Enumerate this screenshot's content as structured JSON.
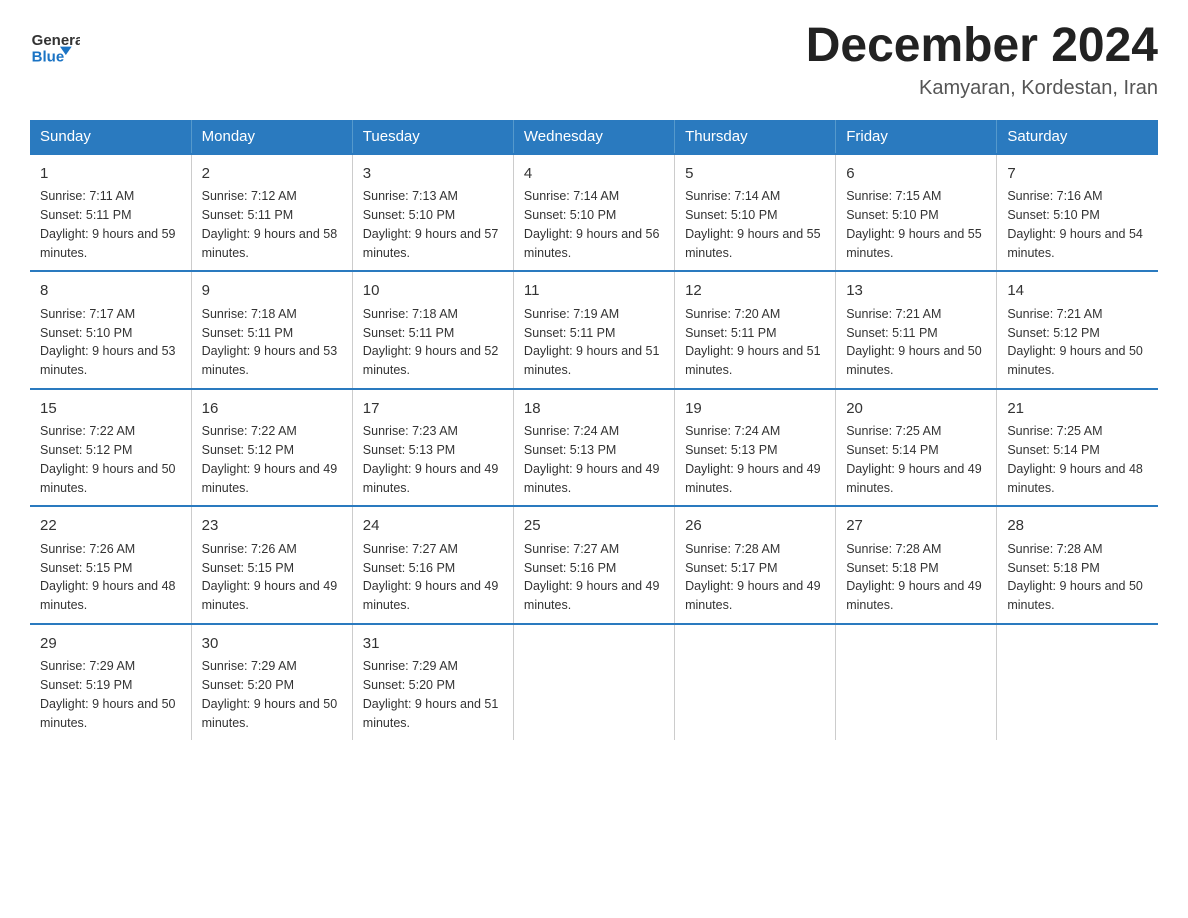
{
  "header": {
    "logo_general": "General",
    "logo_blue": "Blue",
    "month_year": "December 2024",
    "location": "Kamyaran, Kordestan, Iran"
  },
  "days_of_week": [
    "Sunday",
    "Monday",
    "Tuesday",
    "Wednesday",
    "Thursday",
    "Friday",
    "Saturday"
  ],
  "weeks": [
    [
      {
        "day": "1",
        "sunrise": "7:11 AM",
        "sunset": "5:11 PM",
        "daylight": "9 hours and 59 minutes."
      },
      {
        "day": "2",
        "sunrise": "7:12 AM",
        "sunset": "5:11 PM",
        "daylight": "9 hours and 58 minutes."
      },
      {
        "day": "3",
        "sunrise": "7:13 AM",
        "sunset": "5:10 PM",
        "daylight": "9 hours and 57 minutes."
      },
      {
        "day": "4",
        "sunrise": "7:14 AM",
        "sunset": "5:10 PM",
        "daylight": "9 hours and 56 minutes."
      },
      {
        "day": "5",
        "sunrise": "7:14 AM",
        "sunset": "5:10 PM",
        "daylight": "9 hours and 55 minutes."
      },
      {
        "day": "6",
        "sunrise": "7:15 AM",
        "sunset": "5:10 PM",
        "daylight": "9 hours and 55 minutes."
      },
      {
        "day": "7",
        "sunrise": "7:16 AM",
        "sunset": "5:10 PM",
        "daylight": "9 hours and 54 minutes."
      }
    ],
    [
      {
        "day": "8",
        "sunrise": "7:17 AM",
        "sunset": "5:10 PM",
        "daylight": "9 hours and 53 minutes."
      },
      {
        "day": "9",
        "sunrise": "7:18 AM",
        "sunset": "5:11 PM",
        "daylight": "9 hours and 53 minutes."
      },
      {
        "day": "10",
        "sunrise": "7:18 AM",
        "sunset": "5:11 PM",
        "daylight": "9 hours and 52 minutes."
      },
      {
        "day": "11",
        "sunrise": "7:19 AM",
        "sunset": "5:11 PM",
        "daylight": "9 hours and 51 minutes."
      },
      {
        "day": "12",
        "sunrise": "7:20 AM",
        "sunset": "5:11 PM",
        "daylight": "9 hours and 51 minutes."
      },
      {
        "day": "13",
        "sunrise": "7:21 AM",
        "sunset": "5:11 PM",
        "daylight": "9 hours and 50 minutes."
      },
      {
        "day": "14",
        "sunrise": "7:21 AM",
        "sunset": "5:12 PM",
        "daylight": "9 hours and 50 minutes."
      }
    ],
    [
      {
        "day": "15",
        "sunrise": "7:22 AM",
        "sunset": "5:12 PM",
        "daylight": "9 hours and 50 minutes."
      },
      {
        "day": "16",
        "sunrise": "7:22 AM",
        "sunset": "5:12 PM",
        "daylight": "9 hours and 49 minutes."
      },
      {
        "day": "17",
        "sunrise": "7:23 AM",
        "sunset": "5:13 PM",
        "daylight": "9 hours and 49 minutes."
      },
      {
        "day": "18",
        "sunrise": "7:24 AM",
        "sunset": "5:13 PM",
        "daylight": "9 hours and 49 minutes."
      },
      {
        "day": "19",
        "sunrise": "7:24 AM",
        "sunset": "5:13 PM",
        "daylight": "9 hours and 49 minutes."
      },
      {
        "day": "20",
        "sunrise": "7:25 AM",
        "sunset": "5:14 PM",
        "daylight": "9 hours and 49 minutes."
      },
      {
        "day": "21",
        "sunrise": "7:25 AM",
        "sunset": "5:14 PM",
        "daylight": "9 hours and 48 minutes."
      }
    ],
    [
      {
        "day": "22",
        "sunrise": "7:26 AM",
        "sunset": "5:15 PM",
        "daylight": "9 hours and 48 minutes."
      },
      {
        "day": "23",
        "sunrise": "7:26 AM",
        "sunset": "5:15 PM",
        "daylight": "9 hours and 49 minutes."
      },
      {
        "day": "24",
        "sunrise": "7:27 AM",
        "sunset": "5:16 PM",
        "daylight": "9 hours and 49 minutes."
      },
      {
        "day": "25",
        "sunrise": "7:27 AM",
        "sunset": "5:16 PM",
        "daylight": "9 hours and 49 minutes."
      },
      {
        "day": "26",
        "sunrise": "7:28 AM",
        "sunset": "5:17 PM",
        "daylight": "9 hours and 49 minutes."
      },
      {
        "day": "27",
        "sunrise": "7:28 AM",
        "sunset": "5:18 PM",
        "daylight": "9 hours and 49 minutes."
      },
      {
        "day": "28",
        "sunrise": "7:28 AM",
        "sunset": "5:18 PM",
        "daylight": "9 hours and 50 minutes."
      }
    ],
    [
      {
        "day": "29",
        "sunrise": "7:29 AM",
        "sunset": "5:19 PM",
        "daylight": "9 hours and 50 minutes."
      },
      {
        "day": "30",
        "sunrise": "7:29 AM",
        "sunset": "5:20 PM",
        "daylight": "9 hours and 50 minutes."
      },
      {
        "day": "31",
        "sunrise": "7:29 AM",
        "sunset": "5:20 PM",
        "daylight": "9 hours and 51 minutes."
      },
      null,
      null,
      null,
      null
    ]
  ],
  "labels": {
    "sunrise_prefix": "Sunrise: ",
    "sunset_prefix": "Sunset: ",
    "daylight_prefix": "Daylight: "
  }
}
